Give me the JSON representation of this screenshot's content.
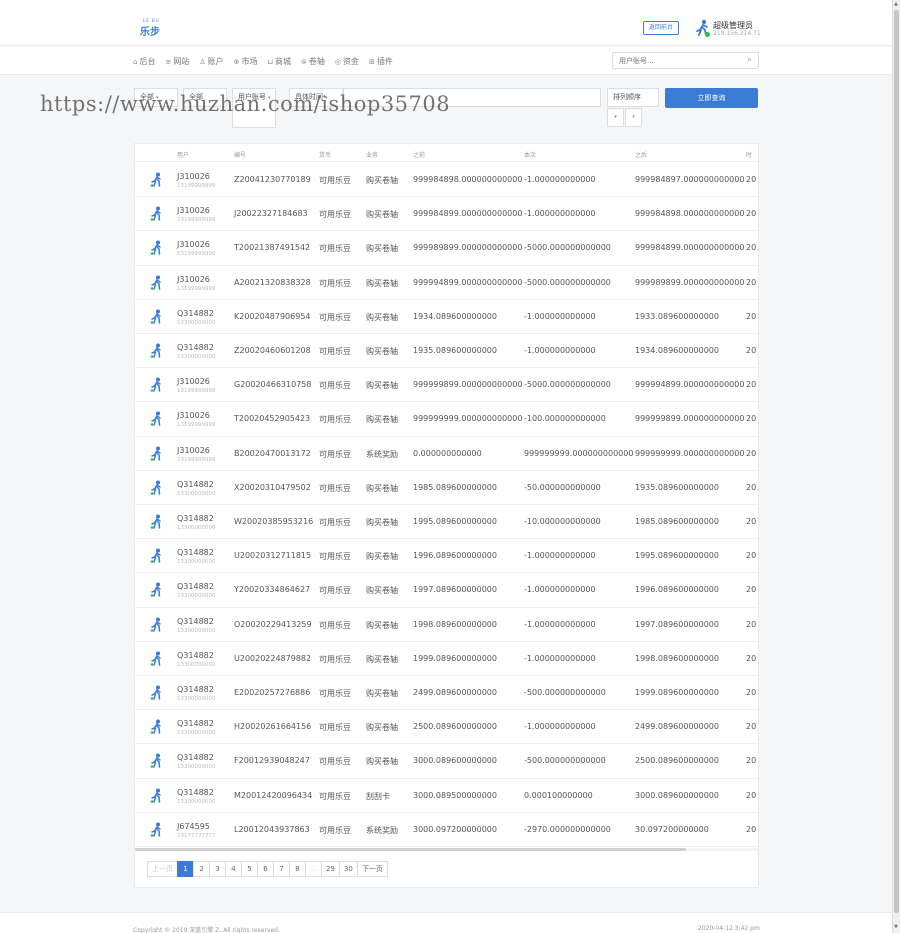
{
  "brand": {
    "logo_small": "LE BU",
    "logo_name": "乐步"
  },
  "header": {
    "back_label": "返回前台",
    "admin_name": "超级管理员",
    "admin_ip": "219.156.214.71"
  },
  "nav": [
    {
      "icon": "home-icon",
      "label": "后台"
    },
    {
      "icon": "menu-icon",
      "label": "网站"
    },
    {
      "icon": "users-icon",
      "label": "账户"
    },
    {
      "icon": "globe-icon",
      "label": "市场"
    },
    {
      "icon": "cart-icon",
      "label": "商城"
    },
    {
      "icon": "scroll-icon",
      "label": "卷轴"
    },
    {
      "icon": "coin-icon",
      "label": "资金"
    },
    {
      "icon": "grid-icon",
      "label": "插件"
    }
  ],
  "search": {
    "placeholder": "用户账号..."
  },
  "filters": {
    "scope": "全部",
    "type": "全部",
    "field": "用户账号",
    "time": "具体时间",
    "sort_label": "排列顺序",
    "query_label": "立即查询"
  },
  "watermark": "https://www.huzhan.com/ishop35708",
  "table": {
    "headers": [
      "用户",
      "编号",
      "货币",
      "业务",
      "之前",
      "本次",
      "之后",
      "时"
    ],
    "rows": [
      {
        "user": "J310026",
        "phone": "13199999999",
        "no": "Z20041230770189",
        "currency": "可用乐豆",
        "biz": "购买卷轴",
        "before": "999984898.000000000000",
        "delta": "-1.000000000000",
        "after": "999984897.000000000000",
        "time": "20"
      },
      {
        "user": "J310026",
        "phone": "13199999999",
        "no": "J20022327184683",
        "currency": "可用乐豆",
        "biz": "购买卷轴",
        "before": "999984899.000000000000",
        "delta": "-1.000000000000",
        "after": "999984898.000000000000",
        "time": "20"
      },
      {
        "user": "J310026",
        "phone": "13199999999",
        "no": "T20021387491542",
        "currency": "可用乐豆",
        "biz": "购买卷轴",
        "before": "999989899.000000000000",
        "delta": "-5000.000000000000",
        "after": "999984899.000000000000",
        "time": "20"
      },
      {
        "user": "J310026",
        "phone": "13199999999",
        "no": "A20021320838328",
        "currency": "可用乐豆",
        "biz": "购买卷轴",
        "before": "999994899.000000000000",
        "delta": "-5000.000000000000",
        "after": "999989899.000000000000",
        "time": "20"
      },
      {
        "user": "Q314882",
        "phone": "13300000000",
        "no": "K20020487906954",
        "currency": "可用乐豆",
        "biz": "购买卷轴",
        "before": "1934.089600000000",
        "delta": "-1.000000000000",
        "after": "1933.089600000000",
        "time": "20"
      },
      {
        "user": "Q314882",
        "phone": "13300000000",
        "no": "Z20020460601208",
        "currency": "可用乐豆",
        "biz": "购买卷轴",
        "before": "1935.089600000000",
        "delta": "-1.000000000000",
        "after": "1934.089600000000",
        "time": "20"
      },
      {
        "user": "J310026",
        "phone": "13199999999",
        "no": "G20020466310758",
        "currency": "可用乐豆",
        "biz": "购买卷轴",
        "before": "999999899.000000000000",
        "delta": "-5000.000000000000",
        "after": "999994899.000000000000",
        "time": "20"
      },
      {
        "user": "J310026",
        "phone": "13199999999",
        "no": "T20020452905423",
        "currency": "可用乐豆",
        "biz": "购买卷轴",
        "before": "999999999.000000000000",
        "delta": "-100.000000000000",
        "after": "999999899.000000000000",
        "time": "20"
      },
      {
        "user": "J310026",
        "phone": "13199999999",
        "no": "B20020470013172",
        "currency": "可用乐豆",
        "biz": "系统奖励",
        "before": "0.000000000000",
        "delta": "999999999.000000000000",
        "after": "999999999.000000000000",
        "time": "20"
      },
      {
        "user": "Q314882",
        "phone": "13300000000",
        "no": "X20020310479502",
        "currency": "可用乐豆",
        "biz": "购买卷轴",
        "before": "1985.089600000000",
        "delta": "-50.000000000000",
        "after": "1935.089600000000",
        "time": "20"
      },
      {
        "user": "Q314882",
        "phone": "13300000000",
        "no": "W20020385953216",
        "currency": "可用乐豆",
        "biz": "购买卷轴",
        "before": "1995.089600000000",
        "delta": "-10.000000000000",
        "after": "1985.089600000000",
        "time": "20"
      },
      {
        "user": "Q314882",
        "phone": "13300000000",
        "no": "U20020312711815",
        "currency": "可用乐豆",
        "biz": "购买卷轴",
        "before": "1996.089600000000",
        "delta": "-1.000000000000",
        "after": "1995.089600000000",
        "time": "20"
      },
      {
        "user": "Q314882",
        "phone": "13300000000",
        "no": "Y20020334864627",
        "currency": "可用乐豆",
        "biz": "购买卷轴",
        "before": "1997.089600000000",
        "delta": "-1.000000000000",
        "after": "1996.089600000000",
        "time": "20"
      },
      {
        "user": "Q314882",
        "phone": "13300000000",
        "no": "O20020229413259",
        "currency": "可用乐豆",
        "biz": "购买卷轴",
        "before": "1998.089600000000",
        "delta": "-1.000000000000",
        "after": "1997.089600000000",
        "time": "20"
      },
      {
        "user": "Q314882",
        "phone": "13300000000",
        "no": "U20020224879882",
        "currency": "可用乐豆",
        "biz": "购买卷轴",
        "before": "1999.089600000000",
        "delta": "-1.000000000000",
        "after": "1998.089600000000",
        "time": "20"
      },
      {
        "user": "Q314882",
        "phone": "13300000000",
        "no": "E20020257276886",
        "currency": "可用乐豆",
        "biz": "购买卷轴",
        "before": "2499.089600000000",
        "delta": "-500.000000000000",
        "after": "1999.089600000000",
        "time": "20"
      },
      {
        "user": "Q314882",
        "phone": "13300000000",
        "no": "H20020261664156",
        "currency": "可用乐豆",
        "biz": "购买卷轴",
        "before": "2500.089600000000",
        "delta": "-1.000000000000",
        "after": "2499.089600000000",
        "time": "20"
      },
      {
        "user": "Q314882",
        "phone": "13300000000",
        "no": "F20012939048247",
        "currency": "可用乐豆",
        "biz": "购买卷轴",
        "before": "3000.089600000000",
        "delta": "-500.000000000000",
        "after": "2500.089600000000",
        "time": "20"
      },
      {
        "user": "Q314882",
        "phone": "13300000000",
        "no": "M20012420096434",
        "currency": "可用乐豆",
        "biz": "刮刮卡",
        "before": "3000.089500000000",
        "delta": "0.000100000000",
        "after": "3000.089600000000",
        "time": "20"
      },
      {
        "user": "J674595",
        "phone": "13177777777",
        "no": "L20012043937863",
        "currency": "可用乐豆",
        "biz": "系统奖励",
        "before": "3000.097200000000",
        "delta": "-2970.000000000000",
        "after": "30.097200000000",
        "time": "20"
      }
    ]
  },
  "pagination": {
    "prev": "上一页",
    "next": "下一页",
    "pages": [
      "1",
      "2",
      "3",
      "4",
      "5",
      "6",
      "7",
      "8",
      "...",
      "29",
      "30"
    ],
    "current": "1"
  },
  "footer": {
    "copyright": "Copyright © 2019 深蓝引擎 Z. All rights reserved.",
    "time": "2020-04-12 3:42 pm"
  },
  "colors": {
    "accent": "#3a7bd5",
    "online": "#27c24c",
    "avatar_green": "#27c24c"
  }
}
